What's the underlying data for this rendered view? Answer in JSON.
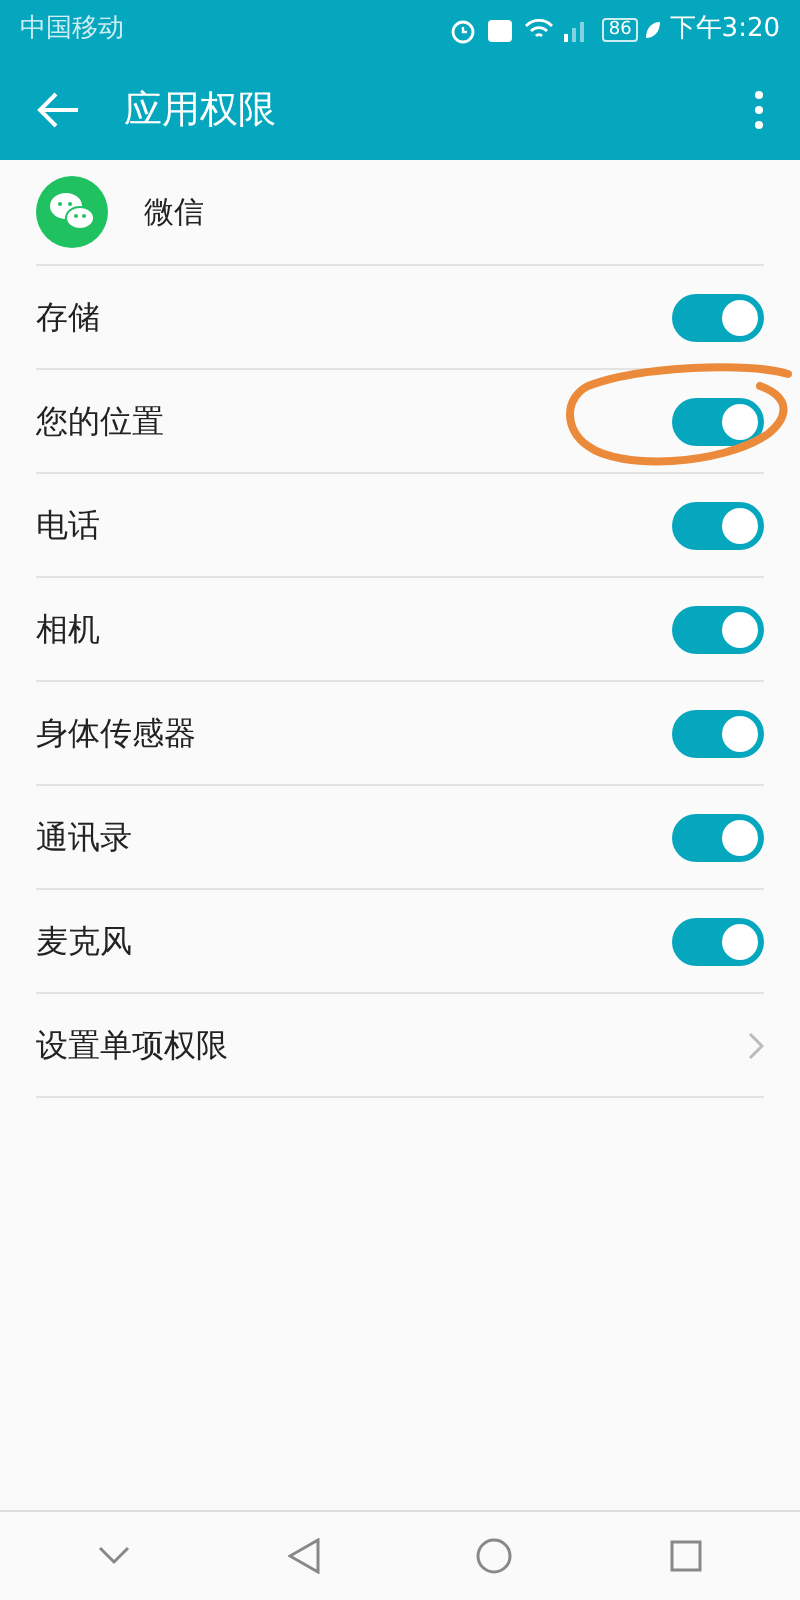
{
  "status_bar": {
    "carrier": "中国移动",
    "battery": "86",
    "time": "下午3:20"
  },
  "header": {
    "title": "应用权限"
  },
  "app": {
    "name": "微信"
  },
  "permissions": [
    {
      "label": "存储",
      "on": true,
      "circled": false
    },
    {
      "label": "您的位置",
      "on": true,
      "circled": true
    },
    {
      "label": "电话",
      "on": true,
      "circled": false
    },
    {
      "label": "相机",
      "on": true,
      "circled": false
    },
    {
      "label": "身体传感器",
      "on": true,
      "circled": false
    },
    {
      "label": "通讯录",
      "on": true,
      "circled": false
    },
    {
      "label": "麦克风",
      "on": true,
      "circled": false
    }
  ],
  "more": {
    "label": "设置单项权限"
  }
}
